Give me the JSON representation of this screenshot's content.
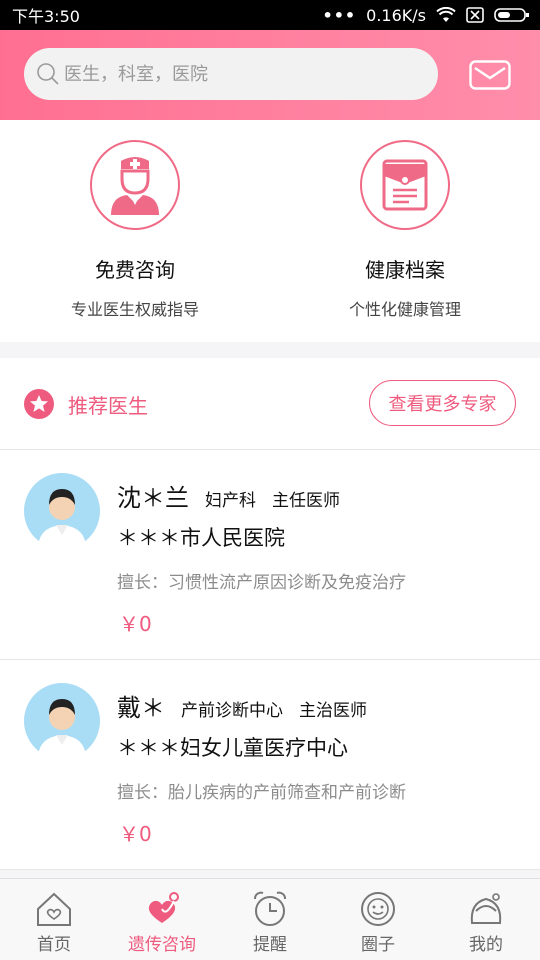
{
  "status_bar": {
    "time": "下午3:50",
    "dots": "•••",
    "speed": "0.16K/s"
  },
  "search": {
    "placeholder": "医生，科室，医院"
  },
  "services": [
    {
      "title": "免费咨询",
      "subtitle": "专业医生权威指导",
      "icon": "doctor-icon"
    },
    {
      "title": "健康档案",
      "subtitle": "个性化健康管理",
      "icon": "archive-folder-icon"
    }
  ],
  "recommended": {
    "title": "推荐医生",
    "more_label": "查看更多专家"
  },
  "doctors": [
    {
      "name": "沈＊兰",
      "dept": "妇产科",
      "title": "主任医师",
      "hospital": "＊＊＊市人民医院",
      "skill": "擅长：习惯性流产原因诊断及免疫治疗",
      "price": "￥0"
    },
    {
      "name": "戴＊",
      "dept": "产前诊断中心",
      "title": "主治医师",
      "hospital": "＊＊＊妇女儿童医疗中心",
      "skill": "擅长：胎儿疾病的产前筛查和产前诊断",
      "price": "￥0"
    }
  ],
  "tabs": [
    {
      "label": "首页",
      "icon": "home-icon",
      "active": false
    },
    {
      "label": "遗传咨询",
      "icon": "heart-stethoscope-icon",
      "active": true
    },
    {
      "label": "提醒",
      "icon": "alarm-clock-icon",
      "active": false
    },
    {
      "label": "圈子",
      "icon": "smiley-icon",
      "active": false
    },
    {
      "label": "我的",
      "icon": "girl-face-icon",
      "active": false
    }
  ],
  "colors": {
    "accent": "#ee5b7e",
    "header_start": "#ff6f91",
    "header_end": "#ff8eab"
  }
}
